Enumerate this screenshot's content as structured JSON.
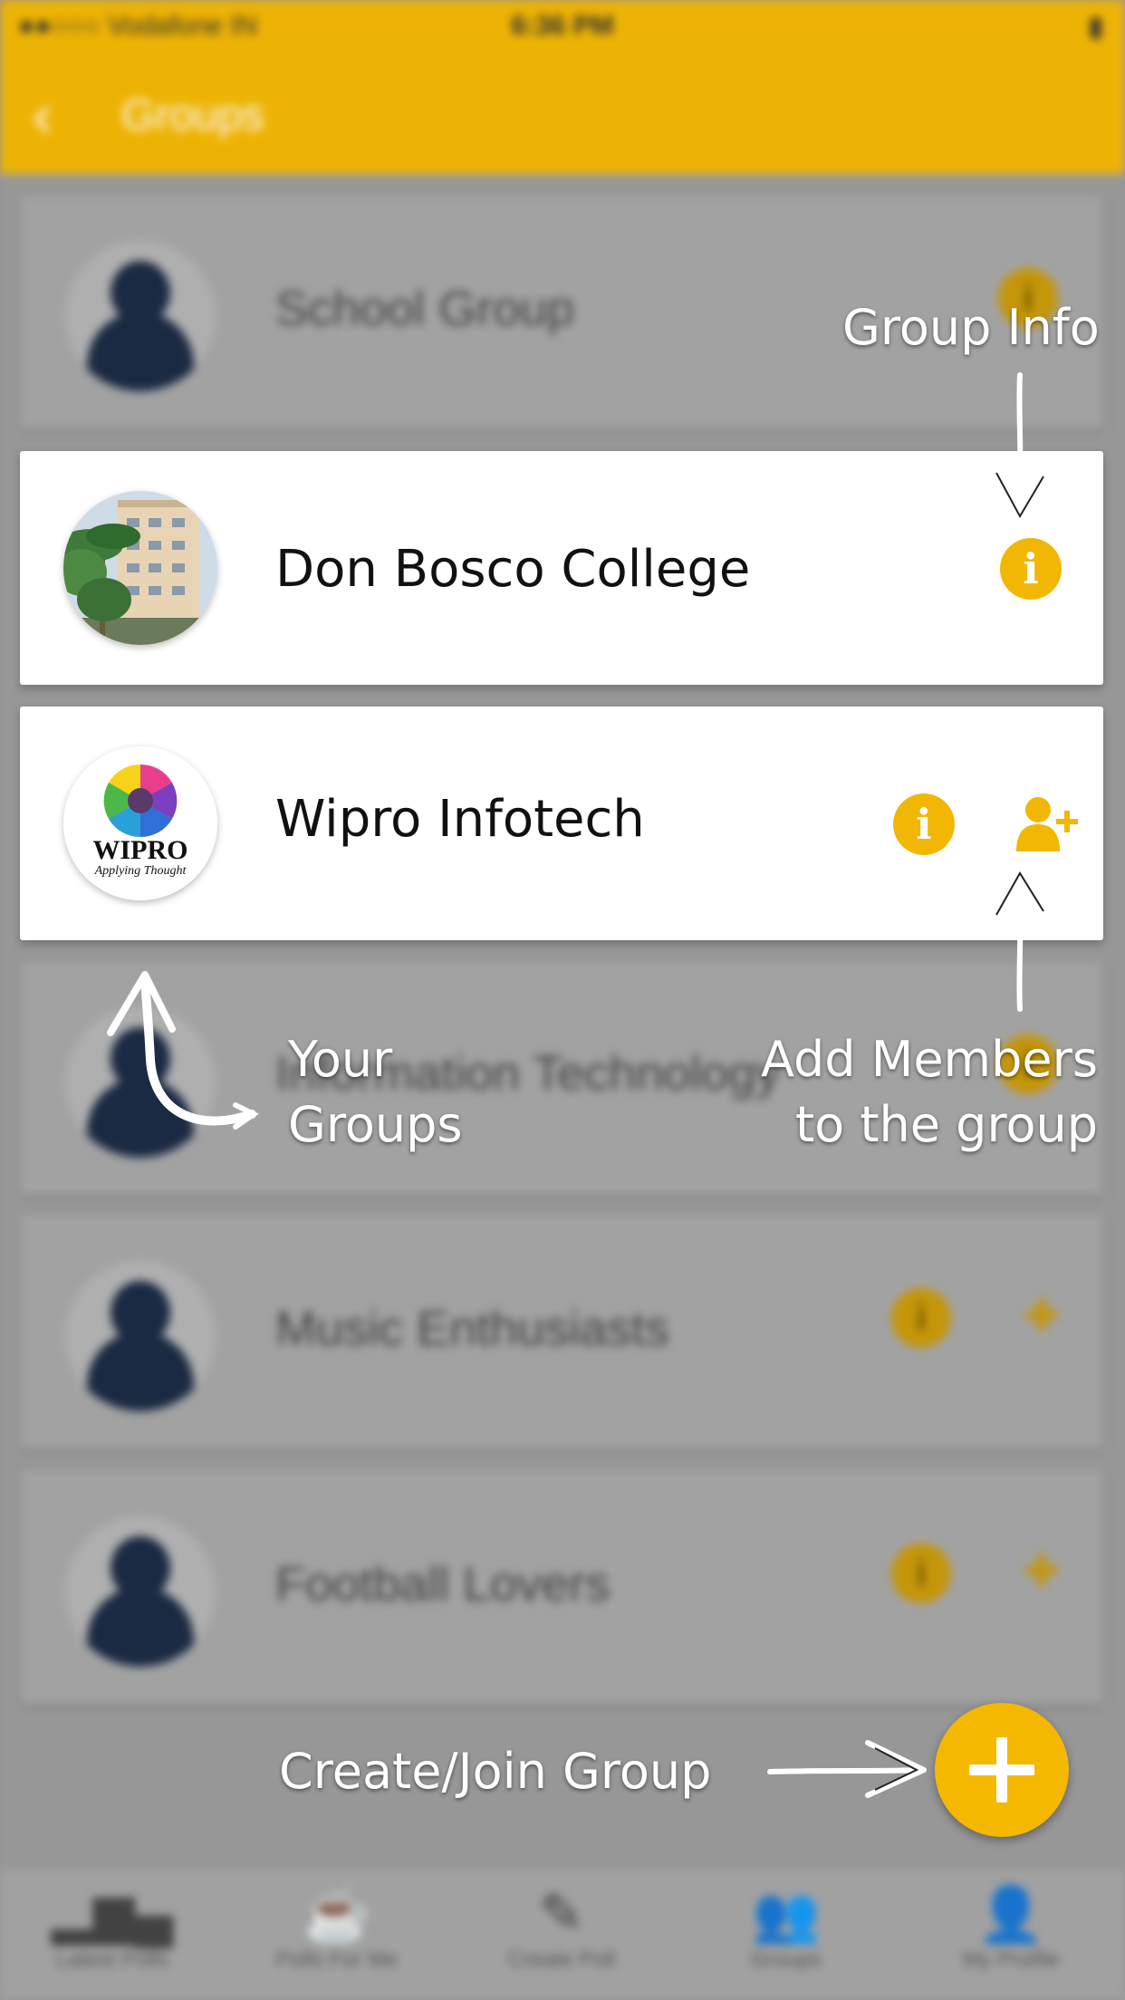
{
  "status_bar": {
    "carrier": "●●○○○ Vodafone IN",
    "time": "6:36 PM",
    "battery": "▮"
  },
  "nav": {
    "back_icon": "chevron-left-icon",
    "title": "Groups"
  },
  "groups": [
    {
      "name": "School Group"
    },
    {
      "name": "Don Bosco College"
    },
    {
      "name": "Wipro Infotech"
    },
    {
      "name": "Information Technology"
    },
    {
      "name": "Music Enthusiasts"
    },
    {
      "name": "Football Lovers"
    }
  ],
  "wipro_logo": {
    "text": "WIPRO",
    "tagline": "Applying Thought"
  },
  "icons": {
    "info": "i",
    "add_member": "add-member-icon",
    "fab": "plus-icon"
  },
  "callouts": {
    "group_info": "Group Info",
    "your_groups_line1": "Your",
    "your_groups_line2": "Groups",
    "add_members_line1": "Add Members",
    "add_members_line2": "to the group",
    "create_join": "Create/Join Group"
  },
  "tabs": [
    {
      "label": "Latest Polls",
      "icon": "bar-chart-icon"
    },
    {
      "label": "Polls For Me",
      "icon": "coffee-cup-icon"
    },
    {
      "label": "Create Poll",
      "icon": "edit-icon"
    },
    {
      "label": "Groups",
      "icon": "people-icon"
    },
    {
      "label": "My Profile",
      "icon": "person-icon"
    }
  ],
  "colors": {
    "accent": "#f2b705",
    "overlay_text": "#ffffff",
    "avatar_dark": "#1b2b44"
  }
}
